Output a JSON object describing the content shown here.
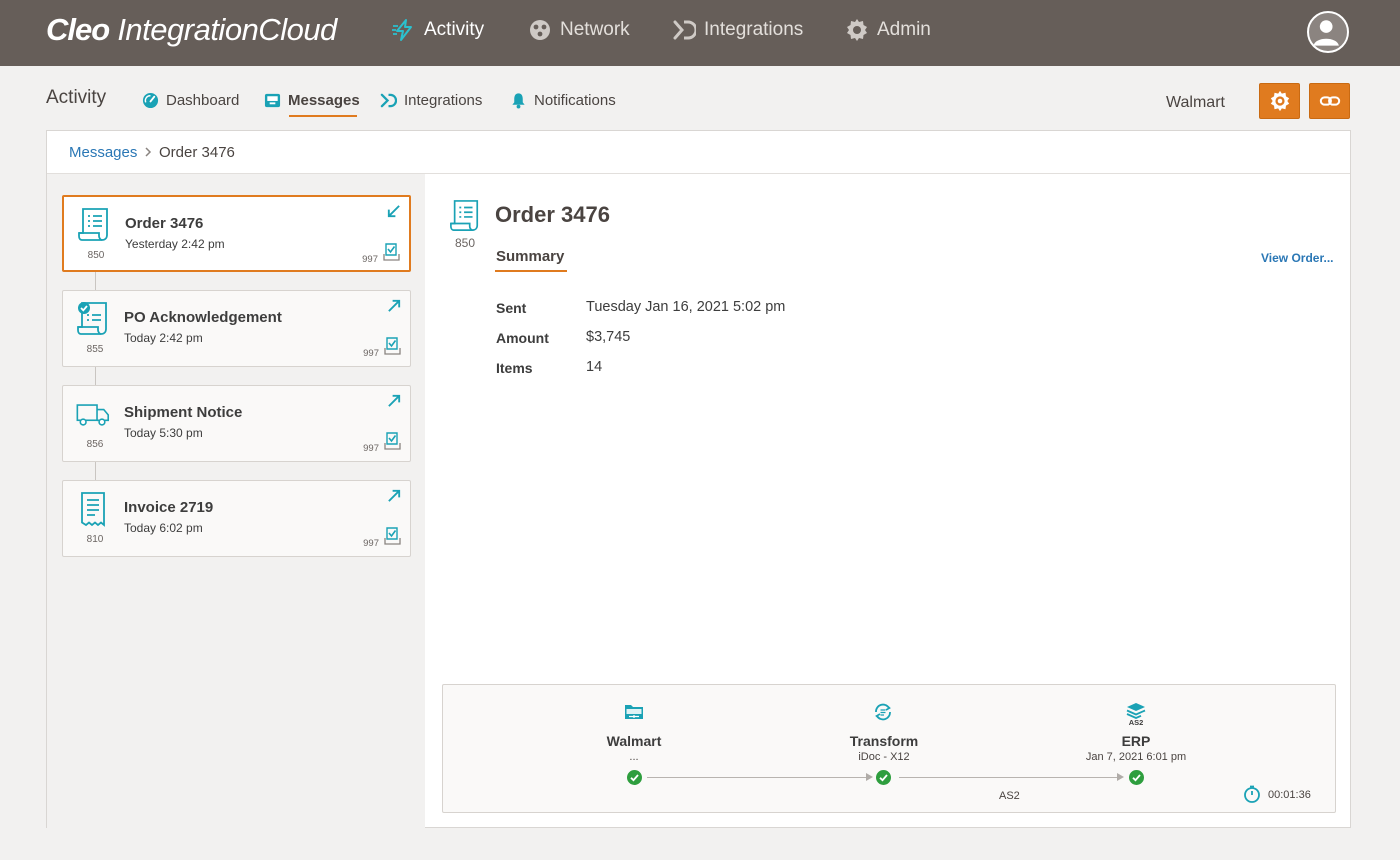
{
  "brand": {
    "name_bold": "Cleo",
    "name_regular": "IntegrationCloud"
  },
  "topnav": [
    {
      "label": "Activity",
      "icon": "bolt-icon",
      "active": true
    },
    {
      "label": "Network",
      "icon": "network-icon",
      "active": false
    },
    {
      "label": "Integrations",
      "icon": "integrations-icon",
      "active": false
    },
    {
      "label": "Admin",
      "icon": "gear-icon",
      "active": false
    }
  ],
  "subnav": {
    "section": "Activity",
    "items": [
      {
        "label": "Dashboard",
        "icon": "gauge-icon"
      },
      {
        "label": "Messages",
        "icon": "inbox-icon",
        "active": true
      },
      {
        "label": "Integrations",
        "icon": "integrations-icon"
      },
      {
        "label": "Notifications",
        "icon": "bell-icon"
      }
    ],
    "account": "Walmart"
  },
  "breadcrumb": {
    "parent": "Messages",
    "current": "Order 3476"
  },
  "messages": [
    {
      "title": "Order 3476",
      "time": "Yesterday 2:42 pm",
      "code": "850",
      "ack": "997",
      "direction": "inbound",
      "selected": true
    },
    {
      "title": "PO Acknowledgement",
      "time": "Today 2:42 pm",
      "code": "855",
      "ack": "997",
      "direction": "outbound"
    },
    {
      "title": "Shipment Notice",
      "time": "Today 5:30 pm",
      "code": "856",
      "ack": "997",
      "direction": "outbound"
    },
    {
      "title": "Invoice 2719",
      "time": "Today 6:02 pm",
      "code": "810",
      "ack": "997",
      "direction": "outbound"
    }
  ],
  "detail": {
    "title": "Order 3476",
    "code": "850",
    "tab": "Summary",
    "view_link": "View Order...",
    "fields": [
      {
        "label": "Sent",
        "value": "Tuesday Jan 16, 2021 5:02 pm"
      },
      {
        "label": "Amount",
        "value": "$3,745"
      },
      {
        "label": "Items",
        "value": "14"
      }
    ]
  },
  "flow": {
    "nodes": [
      {
        "title": "Walmart",
        "sub": "..."
      },
      {
        "title": "Transform",
        "sub": "iDoc - X12"
      },
      {
        "title": "ERP",
        "sub": "Jan 7, 2021  6:01 pm",
        "badge": "AS2"
      }
    ],
    "protocol": "AS2",
    "duration": "00:01:36"
  },
  "colors": {
    "topbar": "#665e59",
    "accent": "#e07b1f",
    "teal": "#1aa2b5",
    "success": "#2e9e3e",
    "link": "#2a77b5"
  }
}
